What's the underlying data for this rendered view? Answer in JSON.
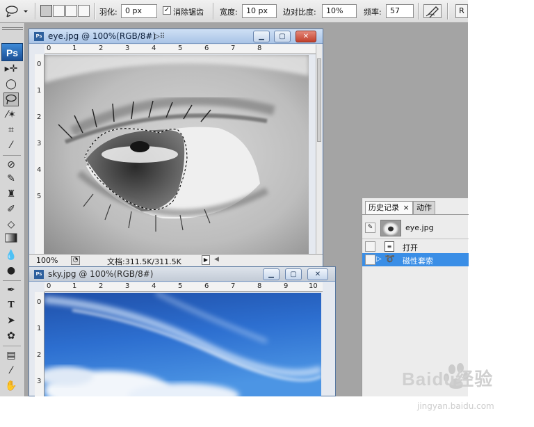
{
  "options_bar": {
    "tool_icon": "magnetic-lasso-icon",
    "feather_label": "羽化:",
    "feather_value": "0 px",
    "antialias_label": "消除锯齿",
    "antialias_checked": true,
    "width_label": "宽度:",
    "width_value": "10 px",
    "edge_contrast_label": "边对比度:",
    "edge_contrast_value": "10%",
    "frequency_label": "频率:",
    "frequency_value": "57",
    "refine_label": "R"
  },
  "toolbox": {
    "logo": "Ps",
    "active_tool": "magnetic-lasso"
  },
  "documents": [
    {
      "title": "eye.jpg @ 100%(RGB/8#)",
      "zoom": "100%",
      "doc_info": "文档:311.5K/311.5K",
      "ruler_h": [
        "0",
        "1",
        "2",
        "3",
        "4",
        "5",
        "6",
        "7",
        "8"
      ],
      "ruler_v": [
        "0",
        "1",
        "2",
        "3",
        "4",
        "5"
      ]
    },
    {
      "title": "sky.jpg @ 100%(RGB/8#)",
      "ruler_h": [
        "0",
        "1",
        "2",
        "3",
        "4",
        "5",
        "6",
        "7",
        "8",
        "9",
        "10"
      ],
      "ruler_v": [
        "0",
        "1",
        "2",
        "3"
      ]
    }
  ],
  "history_panel": {
    "tabs": [
      "历史记录",
      "动作"
    ],
    "tab_close": "×",
    "snapshot_name": "eye.jpg",
    "items": [
      {
        "label": "打开",
        "selected": false
      },
      {
        "label": "磁性套索",
        "selected": true
      }
    ]
  },
  "watermark": {
    "brand": "Baidu经验",
    "url": "jingyan.baidu.com"
  },
  "colors": {
    "selection_highlight": "#3a8ee6",
    "titlebar": "#b9d1ee",
    "workspace": "#a4a4a4"
  }
}
